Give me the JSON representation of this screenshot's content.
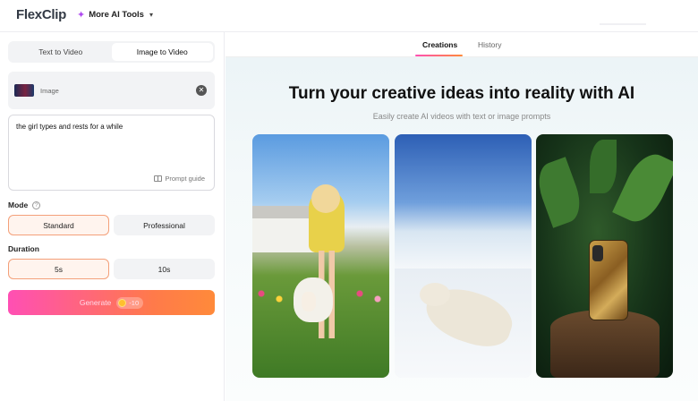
{
  "app": {
    "name": "FlexClip",
    "menu_label": "More AI Tools"
  },
  "left_tabs": [
    {
      "label": "Text to Video",
      "active": false
    },
    {
      "label": "Image to Video",
      "active": true
    }
  ],
  "image_upload": {
    "label": "Image"
  },
  "prompt": {
    "value": "the girl types and rests for a while",
    "guide_label": "Prompt guide"
  },
  "mode": {
    "label": "Mode",
    "options": [
      {
        "label": "Standard",
        "selected": true
      },
      {
        "label": "Professional",
        "selected": false
      }
    ]
  },
  "duration": {
    "label": "Duration",
    "options": [
      {
        "label": "5s",
        "selected": true
      },
      {
        "label": "10s",
        "selected": false
      }
    ]
  },
  "generate": {
    "label": "Generate",
    "cost": "-10"
  },
  "right_tabs": [
    {
      "label": "Creations",
      "active": true
    },
    {
      "label": "History",
      "active": false
    }
  ],
  "hero": {
    "title": "Turn your creative ideas into reality with AI",
    "subtitle": "Easily create AI videos with text or image prompts"
  },
  "colors": {
    "accent_start": "#ff4fb4",
    "accent_end": "#ff8a3a",
    "logo_mark": "#ff7a1a"
  }
}
